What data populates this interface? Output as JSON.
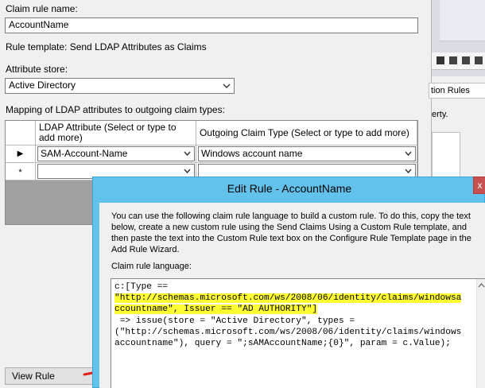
{
  "claim_rule": {
    "name_label": "Claim rule name:",
    "name_value": "AccountName",
    "template_text": "Rule template: Send LDAP Attributes as Claims",
    "attribute_store_label": "Attribute store:",
    "attribute_store_value": "Active Directory",
    "mapping_label": "Mapping of LDAP attributes to outgoing claim types:"
  },
  "mapping_grid": {
    "columns": [
      "LDAP Attribute (Select or type to add more)",
      "Outgoing Claim Type (Select or type to add more)"
    ],
    "rows": [
      {
        "marker": "▶",
        "ldap": "SAM-Account-Name",
        "claim": "Windows account name"
      },
      {
        "marker": "*",
        "ldap": "",
        "claim": ""
      }
    ]
  },
  "view_rule_button": "View Rule Language",
  "background_window": {
    "tab_label": "tion Rules",
    "text_fragment": "erty."
  },
  "dialog": {
    "title": "Edit Rule - AccountName",
    "close_glyph": "x",
    "intro": "You can use the following claim rule language to build a custom rule. To do this, copy the text below, create a new custom rule using the Send Claims Using a Custom Rule template, and then paste the text into the Custom Rule text box on the Configure Rule Template page in the Add Rule Wizard.",
    "code_label": "Claim rule language:",
    "code_lines": [
      "c:[Type ==",
      "\"http://schemas.microsoft.com/ws/2008/06/identity/claims/windowsa",
      "ccountname\", Issuer == \"AD AUTHORITY\"]",
      " => issue(store = \"Active Directory\", types =",
      "(\"http://schemas.microsoft.com/ws/2008/06/identity/claims/windows",
      "accountname\"), query = \";sAMAccountName;{0}\", param = c.Value);"
    ]
  },
  "colors": {
    "dialog_frame": "#62c2eb",
    "highlight": "#ffff33",
    "arrow": "#e0201a"
  }
}
